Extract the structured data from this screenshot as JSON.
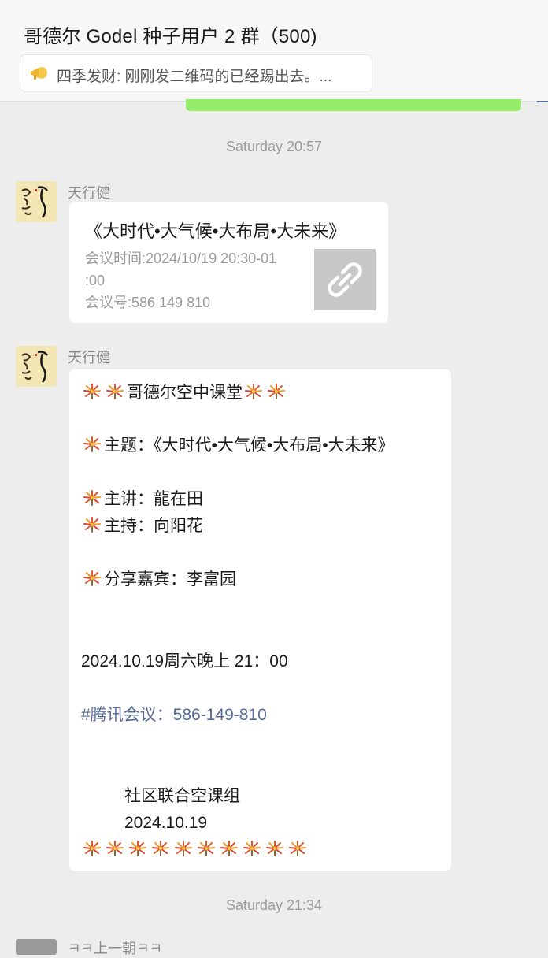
{
  "header": {
    "title": "哥德尔 Godel 种子用户 2 群（500)",
    "pinned_icon": "bullhorn-icon",
    "pinned_text": "四季发财: 刚刚发二维码的已经踢出去。..."
  },
  "timestamps": {
    "first": "Saturday 20:57",
    "second": "Saturday 21:34"
  },
  "messages": {
    "link": {
      "sender": "天行健",
      "title": "《大时代•大气候•大布局•大未来》",
      "desc_line1": "会议时间:2024/10/19 20:30-01",
      "desc_line2": ":00",
      "desc_line3": "会议号:586 149 810",
      "thumb_icon": "link-icon"
    },
    "text": {
      "sender": "天行健",
      "emoji": "firework-emoji",
      "line1": "哥德尔空中课堂",
      "line2": "主题：《大时代•大气候•大布局•大未来》",
      "line3": "主讲：龍在田",
      "line4": "主持：向阳花",
      "line5": "分享嘉宾：李富园",
      "line6": "2024.10.19周六晚上 21：00",
      "line7": "#腾讯会议：586-149-810",
      "line8": "社区联合空课组",
      "line9": "2024.10.19"
    }
  },
  "bottom_sender": "ㅋㅋ上一朝ㅋㅋ",
  "colors": {
    "background": "#ededed",
    "bubble_self": "#95ec69",
    "bubble_other": "#ffffff",
    "link_blue": "#576b95"
  }
}
